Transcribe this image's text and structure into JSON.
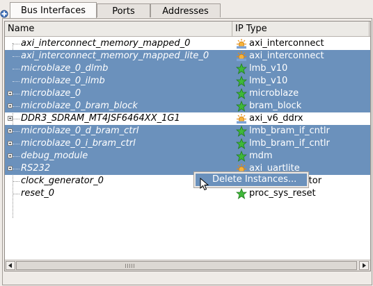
{
  "tabs": [
    {
      "label": "Bus Interfaces",
      "active": true
    },
    {
      "label": "Ports",
      "active": false
    },
    {
      "label": "Addresses",
      "active": false
    }
  ],
  "columns": {
    "name": "Name",
    "ip_type": "IP Type"
  },
  "rows": [
    {
      "name": "axi_interconnect_memory_mapped_0",
      "ip": "axi_interconnect",
      "icon": "sun-icon",
      "selected": false,
      "expandable": false
    },
    {
      "name": "axi_interconnect_memory_mapped_lite_0",
      "ip": "axi_interconnect",
      "icon": "sun-icon",
      "selected": true,
      "expandable": false
    },
    {
      "name": "microblaze_0_dlmb",
      "ip": "lmb_v10",
      "icon": "star-icon",
      "selected": true,
      "expandable": false
    },
    {
      "name": "microblaze_0_ilmb",
      "ip": "lmb_v10",
      "icon": "star-icon",
      "selected": true,
      "expandable": false
    },
    {
      "name": "microblaze_0",
      "ip": "microblaze",
      "icon": "star-icon",
      "selected": true,
      "expandable": true
    },
    {
      "name": "microblaze_0_bram_block",
      "ip": "bram_block",
      "icon": "star-icon",
      "selected": true,
      "expandable": true
    },
    {
      "name": "DDR3_SDRAM_MT4JSF6464XX_1G1",
      "ip": "axi_v6_ddrx",
      "icon": "sun-icon",
      "selected": false,
      "expandable": true
    },
    {
      "name": "microblaze_0_d_bram_ctrl",
      "ip": "lmb_bram_if_cntlr",
      "icon": "star-icon",
      "selected": true,
      "expandable": true
    },
    {
      "name": "microblaze_0_i_bram_ctrl",
      "ip": "lmb_bram_if_cntlr",
      "icon": "star-icon",
      "selected": true,
      "expandable": true
    },
    {
      "name": "debug_module",
      "ip": "mdm",
      "icon": "star-icon",
      "selected": true,
      "expandable": true
    },
    {
      "name": "RS232",
      "ip": "axi_uartlite",
      "icon": "sun-icon",
      "selected": true,
      "expandable": true
    },
    {
      "name": "clock_generator_0",
      "ip": "clock_generator",
      "icon": "star-icon",
      "selected": false,
      "expandable": false
    },
    {
      "name": "reset_0",
      "ip": "proc_sys_reset",
      "icon": "star-icon",
      "selected": false,
      "expandable": false
    }
  ],
  "context_menu": {
    "item": "Delete Instances..."
  },
  "colors": {
    "selection": "#6b91bc",
    "star": "#3fb83a",
    "sun": "#f2a531"
  }
}
